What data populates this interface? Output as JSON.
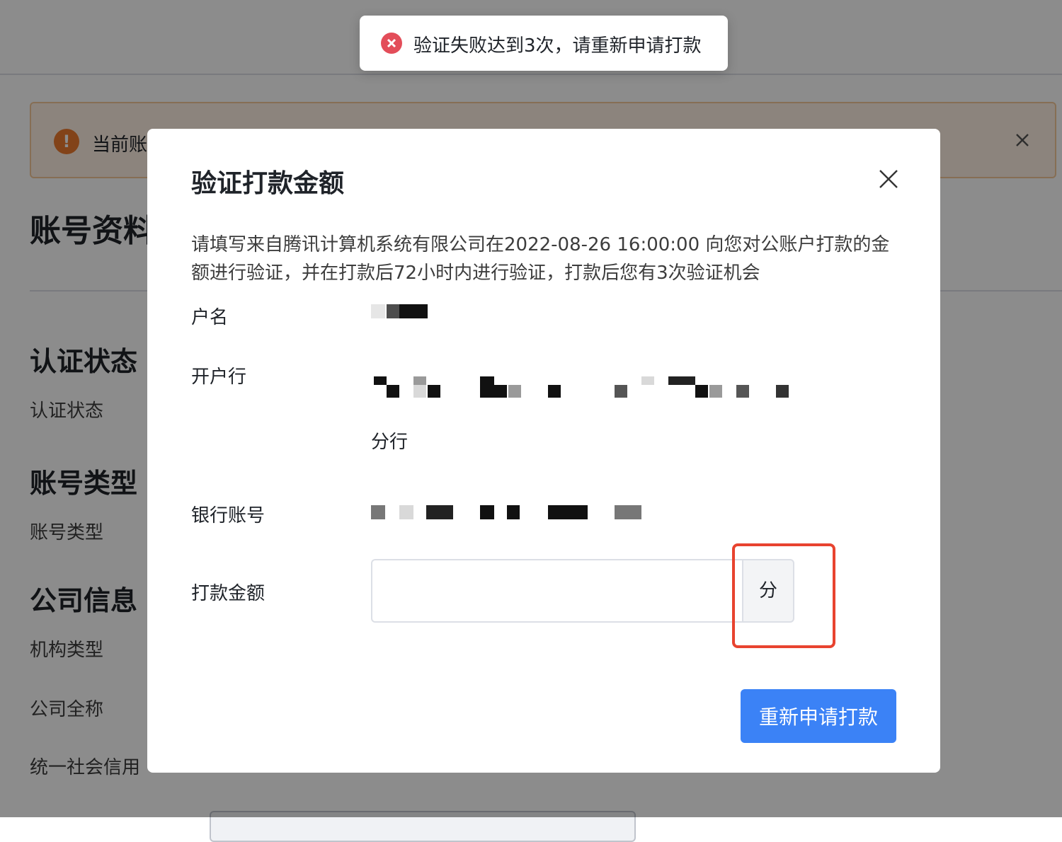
{
  "background": {
    "alert": {
      "text": "当前账",
      "icon": "warning-icon",
      "close_icon": "close-icon"
    },
    "sections": [
      {
        "title": "账号资料"
      },
      {
        "title": "认证状态",
        "label": "认证状态"
      },
      {
        "title": "账号类型",
        "label": "账号类型"
      },
      {
        "title": "公司信息",
        "labels": [
          "机构类型",
          "公司全称",
          "统一社会信用"
        ]
      }
    ]
  },
  "toast": {
    "icon": "error-icon",
    "icon_color": "#e34d59",
    "text": "验证失败达到3次，请重新申请打款"
  },
  "modal": {
    "title": "验证打款金额",
    "close_icon": "close-icon",
    "description": "请填写来自腾讯计算机系统有限公司在2022-08-26 16:00:00 向您对公账户打款的金额进行验证，并在打款后72小时内进行验证，打款后您有3次验证机会",
    "fields": {
      "account_name_label": "户名",
      "bank_label": "开户行",
      "bank_branch_suffix": "分行",
      "account_number_label": "银行账号",
      "amount_label": "打款金额",
      "amount_value": "",
      "amount_unit": "分"
    },
    "submit_label": "重新申请打款",
    "submit_color": "#3b82f6",
    "highlight_color": "#e8432f"
  }
}
